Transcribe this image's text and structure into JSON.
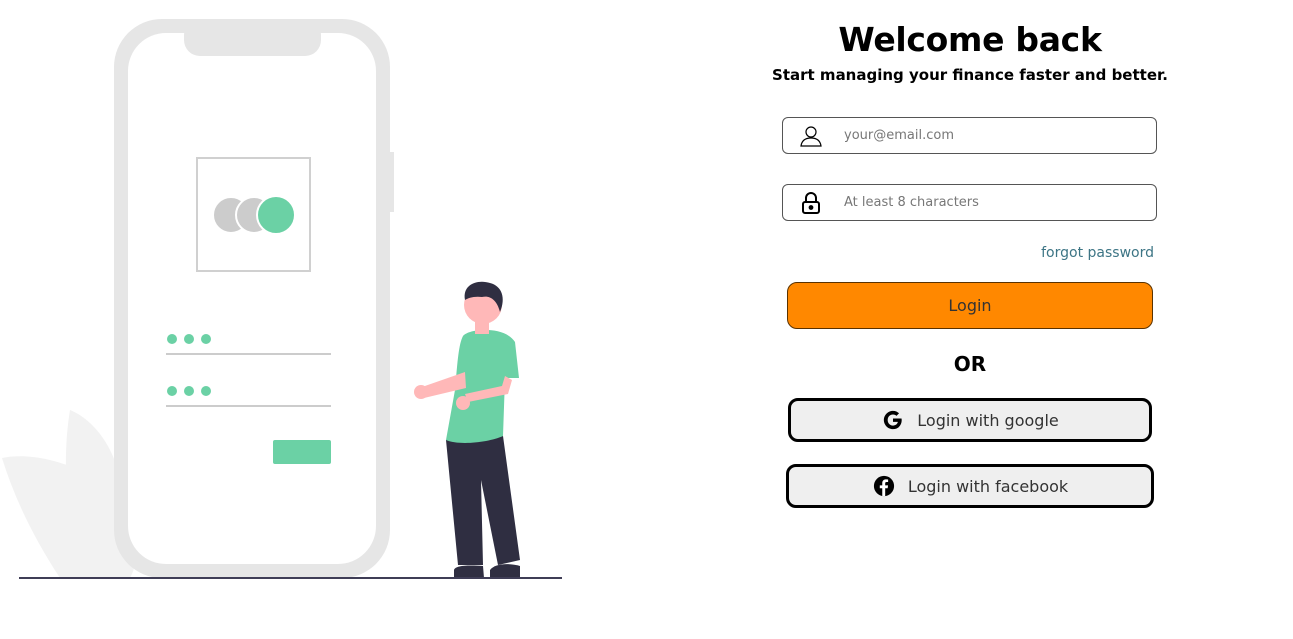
{
  "header": {
    "title": "Welcome back",
    "subtitle": "Start managing your finance faster and better."
  },
  "email_field": {
    "placeholder": "your@email.com",
    "value": "",
    "icon": "user-icon"
  },
  "password_field": {
    "placeholder": "At least 8 characters",
    "value": "",
    "icon": "lock-icon"
  },
  "forgot_password_label": "forgot password",
  "login_label": "Login",
  "divider_label": "OR",
  "social": {
    "google_label": "Login with google",
    "google_icon": "google-icon",
    "facebook_label": "Login with facebook",
    "facebook_icon": "facebook-icon"
  },
  "colors": {
    "accent": "#ff8800",
    "illustration_green": "#6bd1a5",
    "link": "#3d7585"
  }
}
